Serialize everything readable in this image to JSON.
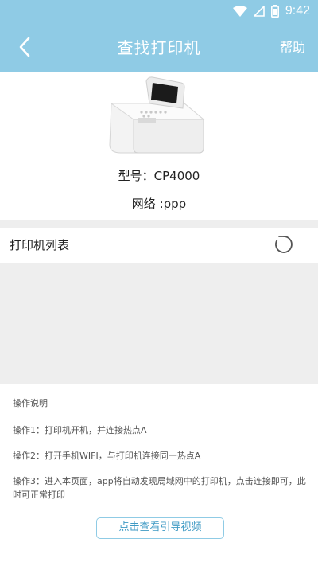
{
  "status_bar": {
    "time": "9:42",
    "icons": [
      "wifi-icon",
      "no-sim-icon",
      "battery-icon"
    ]
  },
  "header": {
    "title": "查找打印机",
    "back_icon": "chevron-left-icon",
    "help_label": "帮助",
    "background_color": "#8fcbe5"
  },
  "printer": {
    "image": "printer-photo",
    "model_label": "型号：CP4000",
    "network_label": "网络 :ppp"
  },
  "printer_list": {
    "title": "打印机列表",
    "refresh_icon": "refresh-spinner-icon",
    "items": []
  },
  "instructions": {
    "title": "操作说明",
    "steps": [
      "操作1：打印机开机，并连接热点A",
      "操作2：打开手机WIFI，与打印机连接同一热点A",
      "操作3：进入本页面，app将自动发现局域网中的打印机，点击连接即可，此时可正常打印"
    ]
  },
  "guide_button": {
    "label": "点击查看引导视频",
    "color": "#3f9ac4"
  }
}
